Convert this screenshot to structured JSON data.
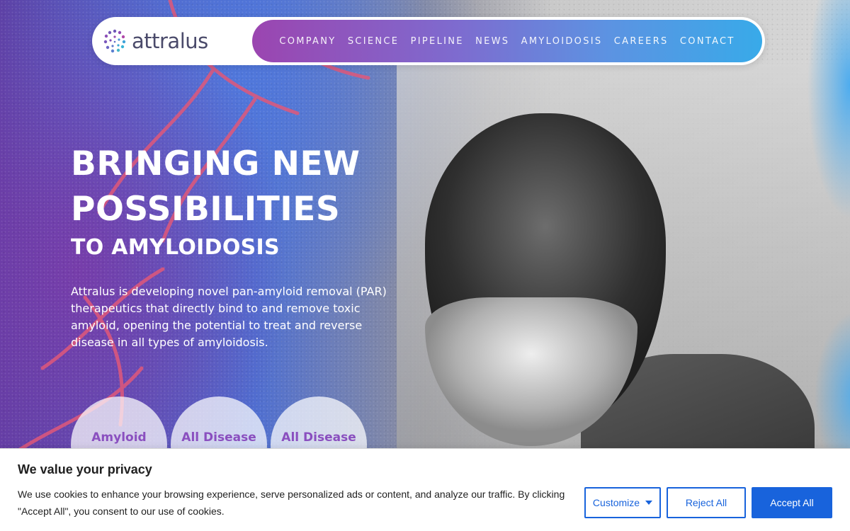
{
  "brand": {
    "logo_text": "attralus",
    "logo_icon": "dotted-circle-logo-icon"
  },
  "nav": {
    "items": [
      {
        "label": "COMPANY"
      },
      {
        "label": "SCIENCE"
      },
      {
        "label": "PIPELINE"
      },
      {
        "label": "NEWS"
      },
      {
        "label": "AMYLOIDOSIS"
      },
      {
        "label": "CAREERS"
      },
      {
        "label": "CONTACT"
      }
    ]
  },
  "hero": {
    "title_line1": "BRINGING NEW",
    "title_line2": "POSSIBILITIES",
    "subtitle": "TO AMYLOIDOSIS",
    "description": "Attralus is developing novel pan-amyloid removal (PAR) therapeutics that directly bind to and remove toxic amyloid, opening the potential to treat and reverse disease in all types of amyloidosis.",
    "circles": [
      {
        "label": "Amyloid"
      },
      {
        "label": "All Disease"
      },
      {
        "label": "All Disease"
      }
    ]
  },
  "cookie": {
    "title": "We value your privacy",
    "text": "We use cookies to enhance your browsing experience, serve personalized ads or content, and analyze our traffic. By clicking \"Accept All\", you consent to our use of cookies.",
    "customize_label": "Customize",
    "reject_label": "Reject All",
    "accept_label": "Accept All"
  },
  "colors": {
    "nav_gradient_start": "#9b45b0",
    "nav_gradient_end": "#38aae9",
    "cookie_accent": "#1863dc",
    "circle_text": "#8a4fbf"
  }
}
